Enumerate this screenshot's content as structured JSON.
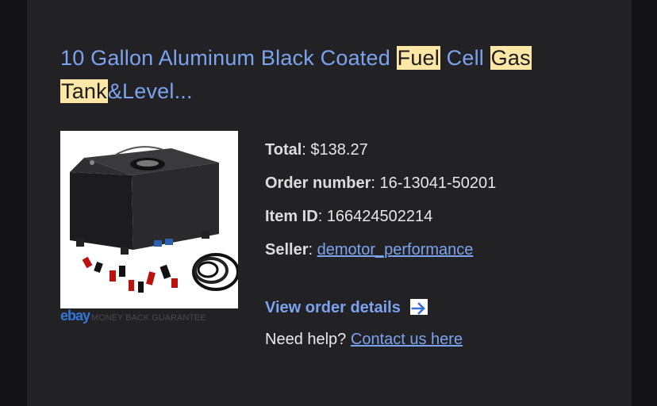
{
  "item": {
    "title_parts": [
      {
        "text": "10 Gallon Aluminum Black Coated ",
        "hl": false
      },
      {
        "text": "Fuel",
        "hl": true
      },
      {
        "text": " Cell ",
        "hl": false
      },
      {
        "text": "Gas",
        "hl": true
      },
      {
        "text": " ",
        "hl": false
      },
      {
        "text": "Tank",
        "hl": true
      },
      {
        "text": "&Level...",
        "hl": false
      }
    ]
  },
  "image": {
    "brand": "ebay",
    "guarantee": "MONEY BACK GUARANTEE"
  },
  "details": {
    "total_label": "Total",
    "total_value": "$138.27",
    "order_label": "Order number",
    "order_value": "16-13041-50201",
    "item_label": "Item ID",
    "item_value": "166424502214",
    "seller_label": "Seller",
    "seller_value": "demotor_performance"
  },
  "actions": {
    "view_order": "View order details",
    "help_text": "Need help?",
    "contact_link": "Contact us here"
  },
  "colors": {
    "link": "#7ba3ef",
    "highlight": "#fde6a6",
    "card": "#222225",
    "background": "#131315"
  }
}
